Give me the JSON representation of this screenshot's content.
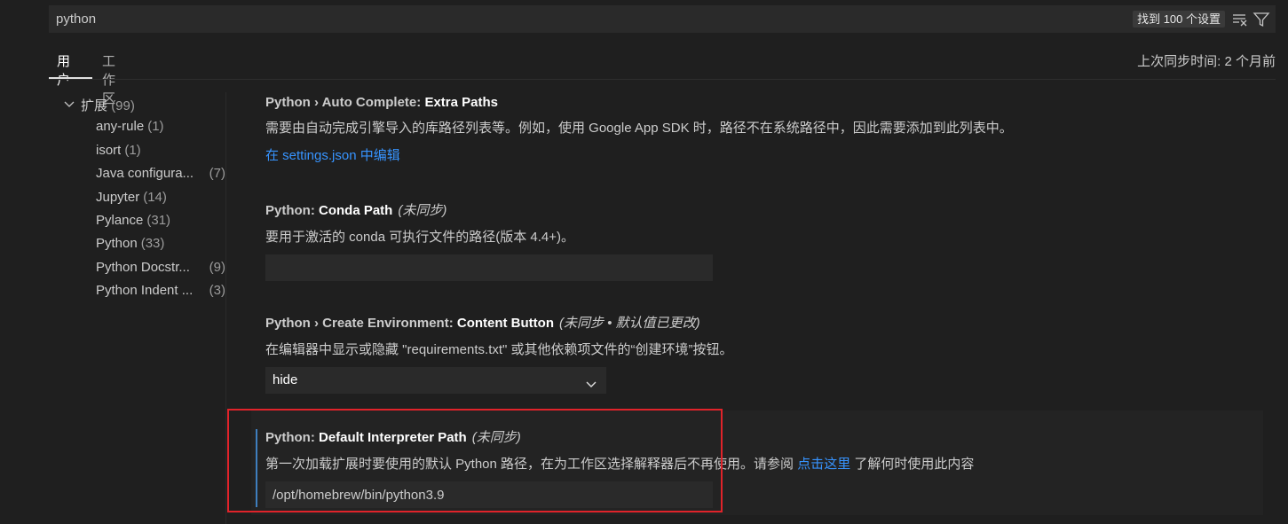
{
  "search": {
    "value": "python",
    "result_count": "找到 100 个设置"
  },
  "tabs": [
    {
      "label": "用户"
    },
    {
      "label": "工作区"
    }
  ],
  "sync_time": "上次同步时间: 2 个月前",
  "toc": {
    "root": {
      "label": "扩展",
      "count": "(99)"
    },
    "items": [
      {
        "label": "any-rule",
        "count": "(1)"
      },
      {
        "label": "isort",
        "count": "(1)"
      },
      {
        "label": "Java configura...",
        "count": "(7)"
      },
      {
        "label": "Jupyter",
        "count": "(14)"
      },
      {
        "label": "Pylance",
        "count": "(31)"
      },
      {
        "label": "Python",
        "count": "(33)"
      },
      {
        "label": "Python Docstr...",
        "count": "(9)"
      },
      {
        "label": "Python Indent ...",
        "count": "(3)"
      }
    ]
  },
  "settings": [
    {
      "category": "Python › Auto Complete: ",
      "name": "Extra Paths",
      "meta": "",
      "description": "需要由自动完成引擎导入的库路径列表等。例如，使用 Google App SDK 时，路径不在系统路径中，因此需要添加到此列表中。",
      "link": "在 settings.json 中编辑"
    },
    {
      "category": "Python: ",
      "name": "Conda Path",
      "meta": "(未同步)",
      "description": "要用于激活的 conda 可执行文件的路径(版本 4.4+)。",
      "value": ""
    },
    {
      "category": "Python › Create Environment: ",
      "name": "Content Button",
      "meta": "(未同步 • 默认值已更改)",
      "description": "在编辑器中显示或隐藏 \"requirements.txt\" 或其他依赖项文件的“创建环境”按钮。",
      "value": "hide"
    },
    {
      "category": "Python: ",
      "name": "Default Interpreter Path",
      "meta": "(未同步)",
      "description_before": "第一次加载扩展时要使用的默认 Python 路径，在为工作区选择解释器后不再使用。请参阅 ",
      "link": "点击这里",
      "description_after": " 了解何时使用此内容",
      "value": "/opt/homebrew/bin/python3.9"
    }
  ],
  "colors": {
    "accent_link": "#3794ff",
    "highlight_border": "#e0232a",
    "focus_bar": "#3f7fbf"
  }
}
